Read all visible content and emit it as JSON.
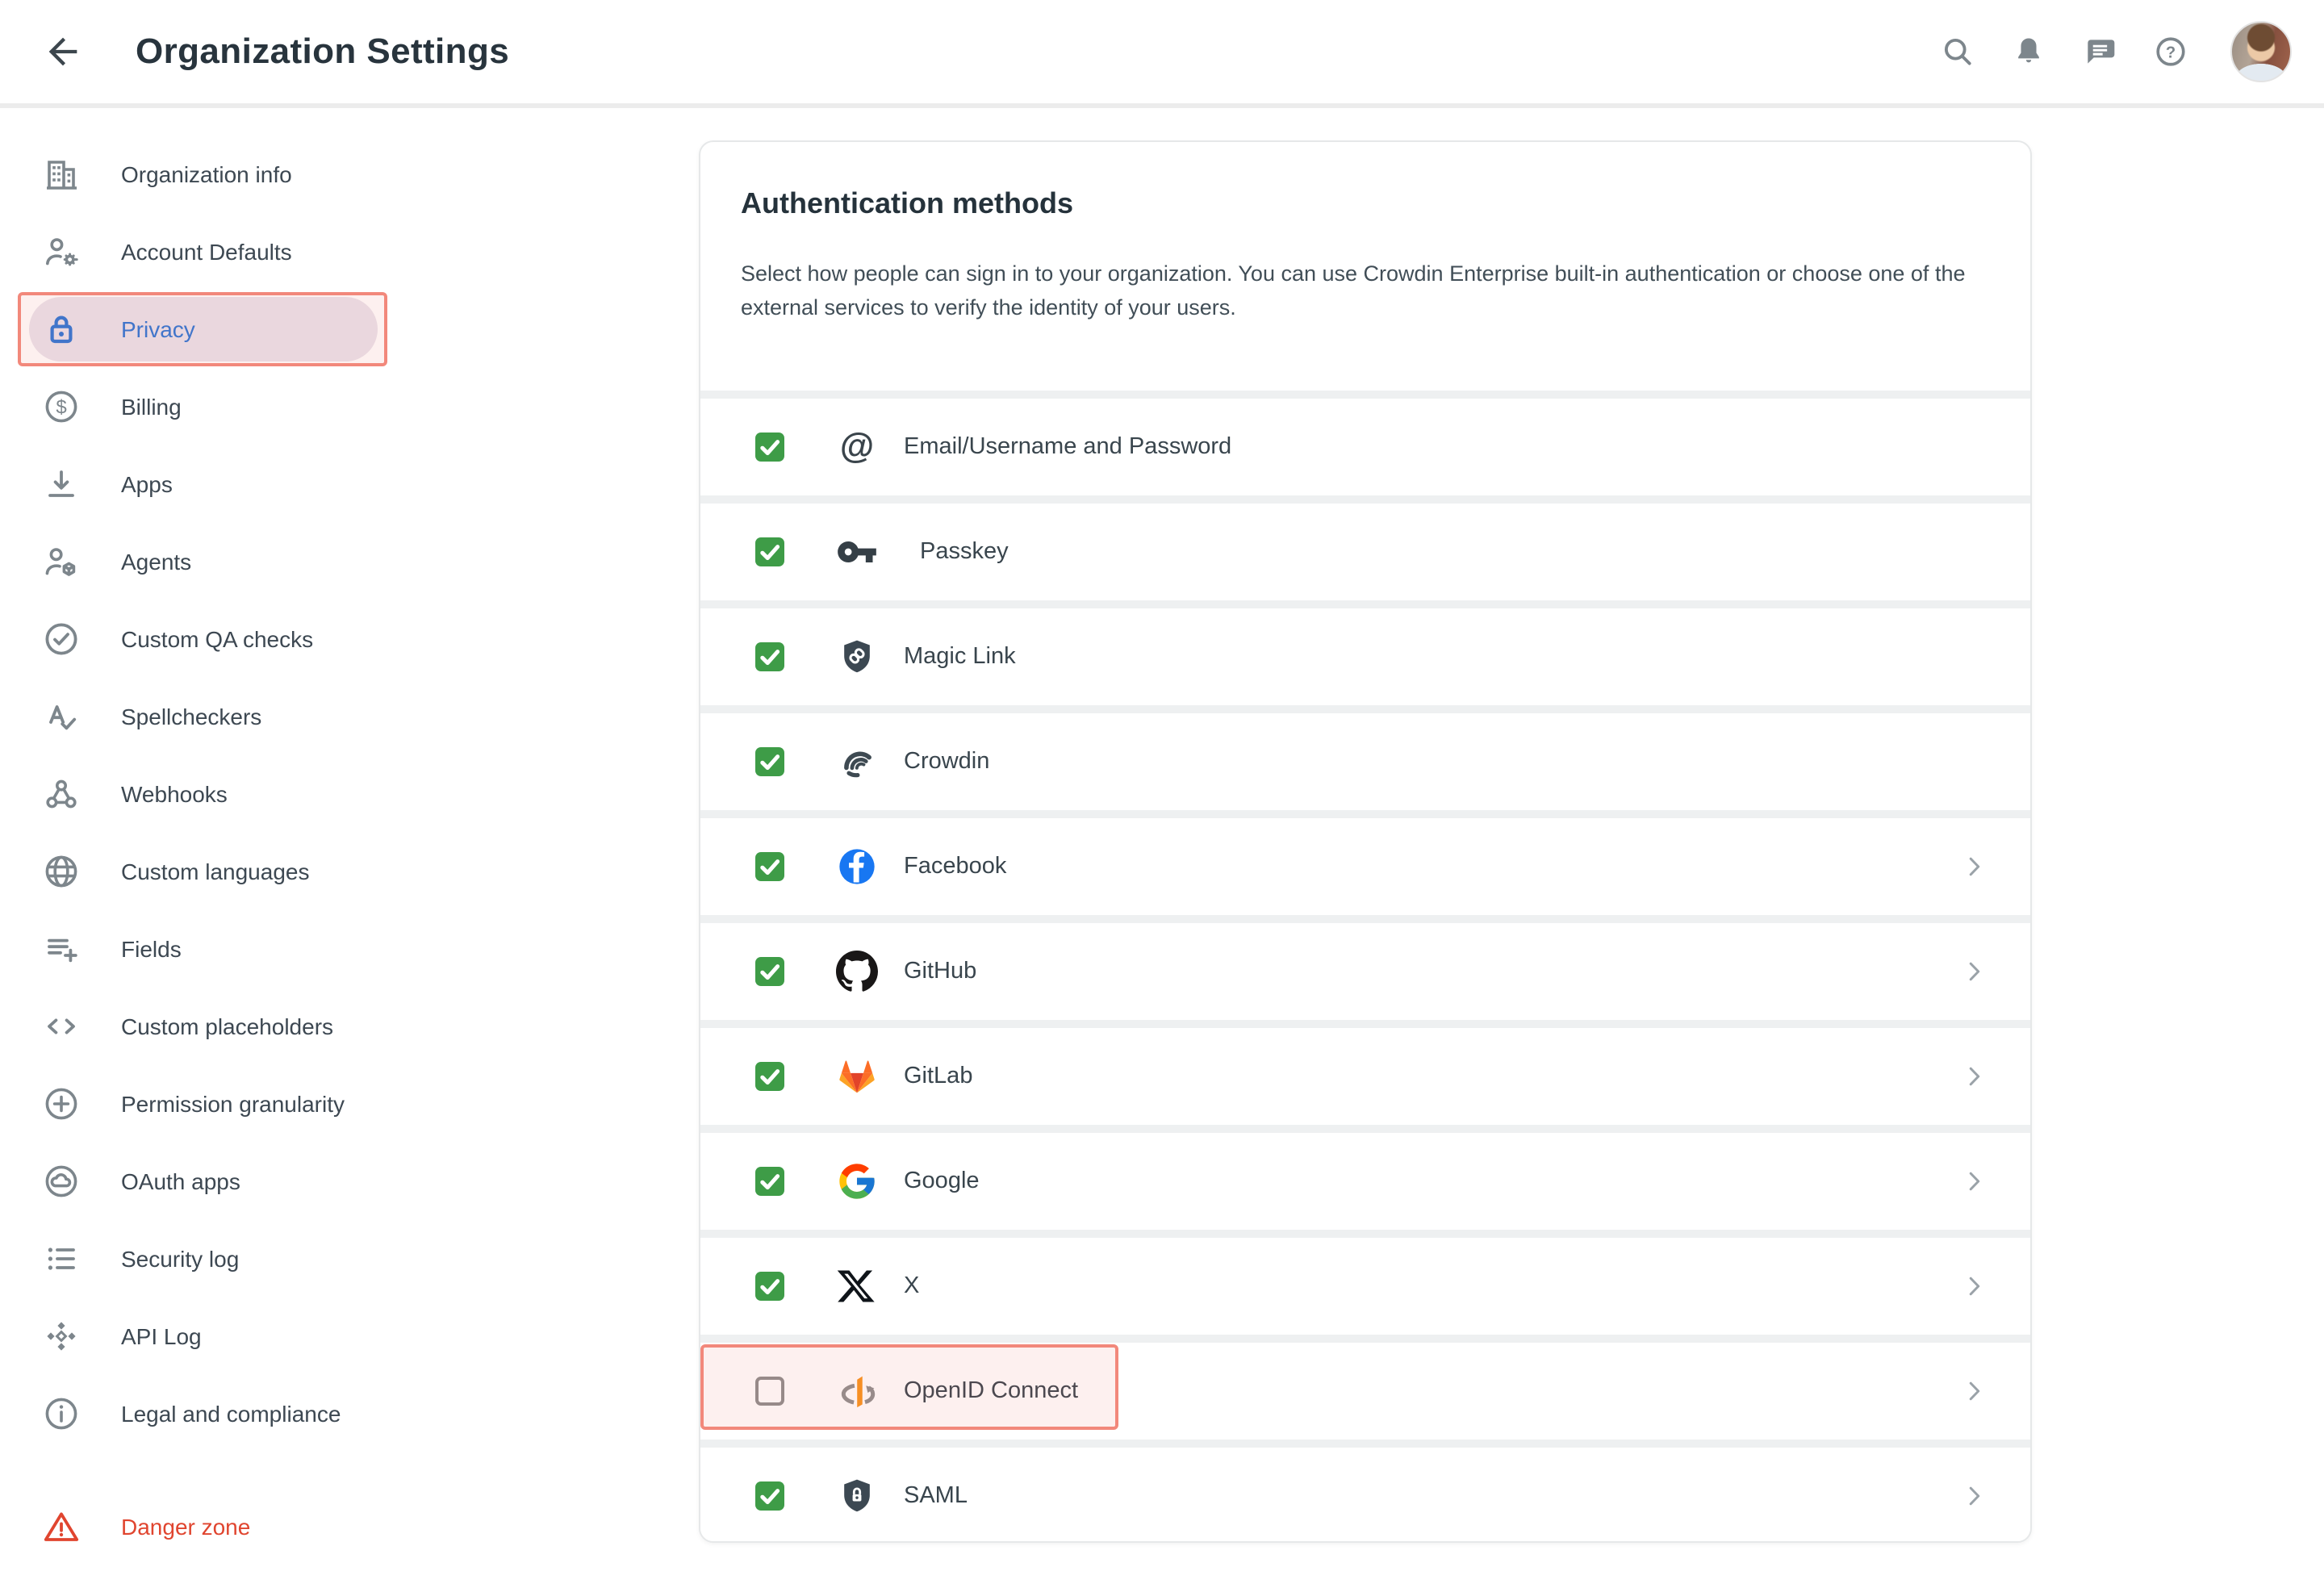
{
  "header": {
    "title": "Organization Settings",
    "back_icon": "arrow-back",
    "actions": [
      {
        "icon": "search"
      },
      {
        "icon": "bell"
      },
      {
        "icon": "chat"
      },
      {
        "icon": "help"
      }
    ]
  },
  "sidebar": {
    "items": [
      {
        "label": "Organization info",
        "icon": "building"
      },
      {
        "label": "Account Defaults",
        "icon": "person-gear"
      },
      {
        "label": "Privacy",
        "icon": "lock",
        "active": true,
        "annotated": true
      },
      {
        "label": "Billing",
        "icon": "dollar-circle"
      },
      {
        "label": "Apps",
        "icon": "download"
      },
      {
        "label": "Agents",
        "icon": "person-box"
      },
      {
        "label": "Custom QA checks",
        "icon": "check-circle"
      },
      {
        "label": "Spellcheckers",
        "icon": "spellcheck"
      },
      {
        "label": "Webhooks",
        "icon": "webhook"
      },
      {
        "label": "Custom languages",
        "icon": "globe"
      },
      {
        "label": "Fields",
        "icon": "playlist-add"
      },
      {
        "label": "Custom placeholders",
        "icon": "code"
      },
      {
        "label": "Permission granularity",
        "icon": "plus-circle"
      },
      {
        "label": "OAuth apps",
        "icon": "cloud-circle"
      },
      {
        "label": "Security log",
        "icon": "list"
      },
      {
        "label": "API Log",
        "icon": "api-diamonds"
      },
      {
        "label": "Legal and compliance",
        "icon": "info-circle"
      },
      {
        "label": "Danger zone",
        "icon": "warning-triangle",
        "danger": true
      }
    ]
  },
  "card": {
    "title": "Authentication methods",
    "description": "Select how people can sign in to your organization. You can use Crowdin Enterprise built-in authentication or choose one of the external services to verify the identity of your users.",
    "methods": [
      {
        "label": "Email/Username and Password",
        "icon": "at-sign",
        "checked": true,
        "chevron": false
      },
      {
        "label": "Passkey",
        "icon": "key",
        "checked": true,
        "chevron": false,
        "indent": true
      },
      {
        "label": "Magic Link",
        "icon": "shield-link",
        "checked": true,
        "chevron": false
      },
      {
        "label": "Crowdin",
        "icon": "crowdin",
        "checked": true,
        "chevron": false
      },
      {
        "label": "Facebook",
        "icon": "facebook",
        "checked": true,
        "chevron": true
      },
      {
        "label": "GitHub",
        "icon": "github",
        "checked": true,
        "chevron": true
      },
      {
        "label": "GitLab",
        "icon": "gitlab",
        "checked": true,
        "chevron": true
      },
      {
        "label": "Google",
        "icon": "google",
        "checked": true,
        "chevron": true
      },
      {
        "label": "X",
        "icon": "x-logo",
        "checked": true,
        "chevron": true
      },
      {
        "label": "OpenID Connect",
        "icon": "openid",
        "checked": false,
        "chevron": true,
        "annotated": true
      },
      {
        "label": "SAML",
        "icon": "shield-lock",
        "checked": true,
        "chevron": true
      }
    ]
  },
  "colors": {
    "accent_blue": "#2e76d6",
    "checkbox_green": "#3e9c47",
    "danger_red": "#e0452f",
    "annotation_red": "#f06e5e",
    "facebook_blue": "#1877f2",
    "openid_orange": "#f8931e",
    "icon_gray": "#7d868c"
  }
}
